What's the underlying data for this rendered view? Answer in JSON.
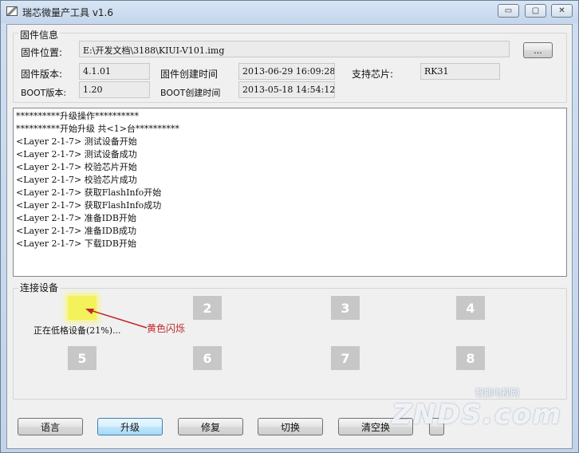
{
  "window": {
    "title": "瑞芯微量产工具 v1.6",
    "controls": {
      "minimize": "▭",
      "maximize": "▢",
      "close": "✕"
    }
  },
  "firmware": {
    "group_label": "固件信息",
    "location_label": "固件位置:",
    "location_value": "E:\\开发文档\\3188\\KIUI-V101.img",
    "browse_label": "...",
    "version_label": "固件版本:",
    "version_value": "4.1.01",
    "create_time_label": "固件创建时间",
    "create_time_value": "2013-06-29 16:09:28",
    "chip_label": "支持芯片:",
    "chip_value": "RK31",
    "boot_version_label": "BOOT版本:",
    "boot_version_value": "1.20",
    "boot_time_label": "BOOT创建时间",
    "boot_time_value": "2013-05-18 14:54:12"
  },
  "log": {
    "lines": [
      "**********升级操作**********",
      "**********开始升级 共<1>台**********",
      "<Layer 2-1-7> 测试设备开始",
      "<Layer 2-1-7> 测试设备成功",
      "<Layer 2-1-7> 校验芯片开始",
      "<Layer 2-1-7> 校验芯片成功",
      "<Layer 2-1-7> 获取FlashInfo开始",
      "<Layer 2-1-7> 获取FlashInfo成功",
      "<Layer 2-1-7> 准备IDB开始",
      "<Layer 2-1-7> 准备IDB成功",
      "<Layer 2-1-7> 下载IDB开始"
    ]
  },
  "devices": {
    "group_label": "连接设备",
    "slots": [
      {
        "label": "",
        "state": "blinking-yellow"
      },
      {
        "label": "2"
      },
      {
        "label": "3"
      },
      {
        "label": "4"
      },
      {
        "label": "5"
      },
      {
        "label": "6"
      },
      {
        "label": "7"
      },
      {
        "label": "8"
      }
    ],
    "status_text": "正在低格设备(21%)...",
    "status_percent": 21,
    "annotation": "黄色闪烁"
  },
  "buttons": {
    "language": "语言",
    "upgrade": "升级",
    "repair": "修复",
    "switch": "切换",
    "clear": "清空换",
    "extra": ""
  },
  "watermark": {
    "main": "ZNDS.com",
    "sub": "智能电视网"
  },
  "colors": {
    "active_slot": "#f4f25a",
    "annotation": "#c0282c",
    "idle_slot": "#c7c7c7"
  }
}
